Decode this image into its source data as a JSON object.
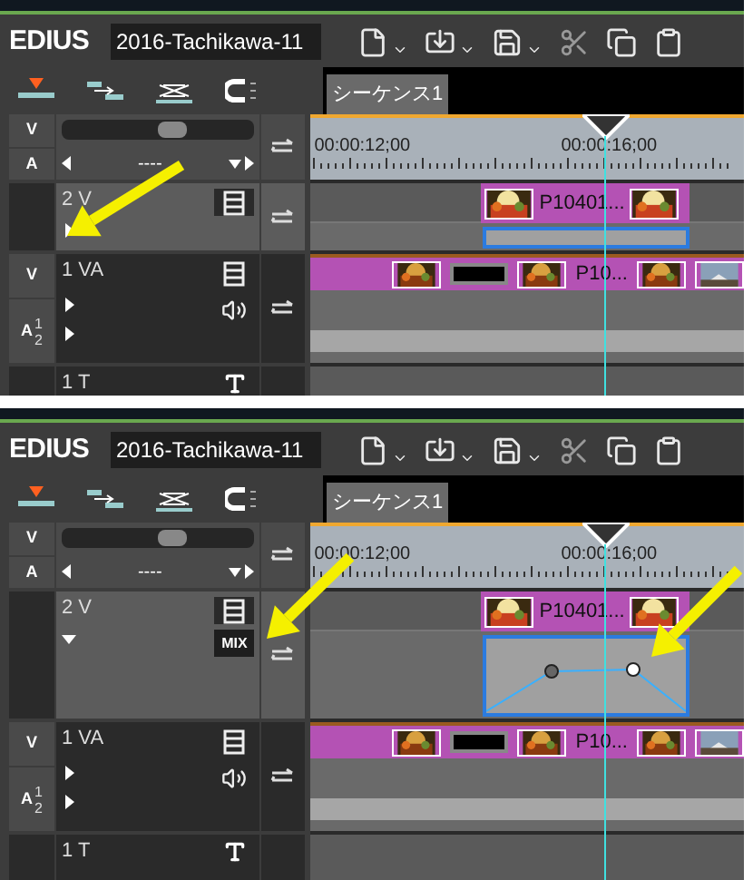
{
  "panels": [
    {
      "app_name": "EDIUS",
      "project": "2016-Tachikawa-11",
      "sequence_tab": "シーケンス1",
      "timecodes": [
        "00:00:12;00",
        "00:00:16;00"
      ],
      "sync_buttons": [
        "V",
        "A"
      ],
      "zoom_slider": {
        "level": 0.57
      },
      "dropdown": {
        "value": "----"
      },
      "tracks": [
        {
          "kind": "video",
          "label": "2 V",
          "expanded": false,
          "clip": "P10401..."
        },
        {
          "kind": "av",
          "label": "1 VA",
          "sync_labels": [
            "V",
            "A"
          ],
          "channels": [
            "1",
            "2"
          ],
          "clip": "P10..."
        },
        {
          "kind": "title",
          "label": "1 T"
        }
      ]
    },
    {
      "app_name": "EDIUS",
      "project": "2016-Tachikawa-11",
      "sequence_tab": "シーケンス1",
      "timecodes": [
        "00:00:12;00",
        "00:00:16;00"
      ],
      "sync_buttons": [
        "V",
        "A"
      ],
      "zoom_slider": {
        "level": 0.57
      },
      "dropdown": {
        "value": "----"
      },
      "tracks": [
        {
          "kind": "video",
          "label": "2 V",
          "expanded": true,
          "mix_label": "MIX",
          "clip": "P10401..."
        },
        {
          "kind": "av",
          "label": "1 VA",
          "sync_labels": [
            "V",
            "A"
          ],
          "channels": [
            "1",
            "2"
          ],
          "clip": "P10..."
        },
        {
          "kind": "title",
          "label": "1 T"
        }
      ]
    }
  ]
}
